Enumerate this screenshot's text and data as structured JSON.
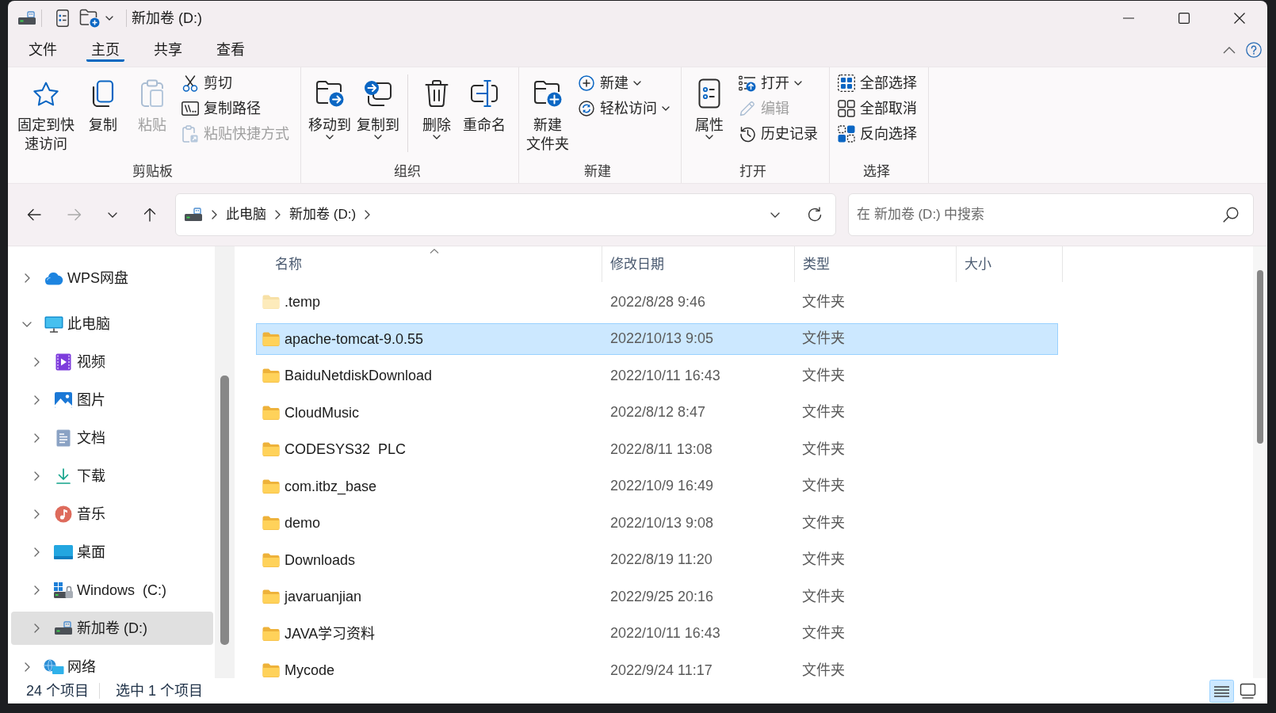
{
  "window": {
    "title": "新加卷 (D:)"
  },
  "ribbon_tabs": [
    {
      "label": "文件",
      "selected": false
    },
    {
      "label": "主页",
      "selected": true
    },
    {
      "label": "共享",
      "selected": false
    },
    {
      "label": "查看",
      "selected": false
    }
  ],
  "ribbon": {
    "groups": [
      {
        "label": "剪贴板",
        "items": [
          {
            "kind": "large",
            "label_lines": [
              "固定到快",
              "速访问"
            ],
            "dropdown": false,
            "disabled": false
          },
          {
            "kind": "large",
            "label": "复制",
            "dropdown": false,
            "disabled": false
          },
          {
            "kind": "large",
            "label": "粘贴",
            "dropdown": false,
            "disabled": true
          },
          {
            "kind": "stack",
            "items": [
              {
                "label": "剪切",
                "dropdown": false,
                "disabled": false
              },
              {
                "label": "复制路径",
                "dropdown": false,
                "disabled": false
              },
              {
                "label": "粘贴快捷方式",
                "dropdown": false,
                "disabled": true
              }
            ]
          }
        ]
      },
      {
        "label": "组织",
        "items": [
          {
            "kind": "large",
            "label": "移动到",
            "dropdown": true,
            "disabled": false
          },
          {
            "kind": "large",
            "label": "复制到",
            "dropdown": true,
            "disabled": false
          },
          {
            "kind": "separator"
          },
          {
            "kind": "large",
            "label": "删除",
            "dropdown": true,
            "disabled": false
          },
          {
            "kind": "large",
            "label": "重命名",
            "dropdown": false,
            "disabled": false
          }
        ]
      },
      {
        "label": "新建",
        "items": [
          {
            "kind": "large",
            "label_lines": [
              "新建",
              "文件夹"
            ],
            "dropdown": false,
            "disabled": false
          },
          {
            "kind": "stack",
            "items": [
              {
                "label": "新建",
                "dropdown": true,
                "disabled": false
              },
              {
                "label": "轻松访问",
                "dropdown": true,
                "disabled": false
              }
            ]
          }
        ]
      },
      {
        "label": "打开",
        "items": [
          {
            "kind": "large",
            "label": "属性",
            "dropdown": true,
            "disabled": false
          },
          {
            "kind": "stack",
            "items": [
              {
                "label": "打开",
                "dropdown": true,
                "disabled": false
              },
              {
                "label": "编辑",
                "dropdown": false,
                "disabled": true
              },
              {
                "label": "历史记录",
                "dropdown": false,
                "disabled": false
              }
            ]
          }
        ]
      },
      {
        "label": "选择",
        "items": [
          {
            "kind": "stack",
            "items": [
              {
                "label": "全部选择",
                "dropdown": false,
                "disabled": false
              },
              {
                "label": "全部取消",
                "dropdown": false,
                "disabled": false
              },
              {
                "label": "反向选择",
                "dropdown": false,
                "disabled": false
              }
            ]
          }
        ]
      }
    ]
  },
  "navigation_buttons": [
    {
      "disabled": false
    },
    {
      "disabled": true
    },
    {
      "disabled": false
    },
    {
      "disabled": false
    }
  ],
  "address_bar": {
    "breadcrumbs": [
      {
        "label": "此电脑"
      },
      {
        "label": "新加卷 (D:)"
      }
    ]
  },
  "search": {
    "placeholder": "在 新加卷 (D:) 中搜索"
  },
  "navigation_pane": {
    "items": [
      {
        "label": "WPS网盘",
        "expanded": false,
        "selected": false
      },
      {
        "label": "此电脑",
        "expanded": true,
        "selected": false,
        "children": [
          {
            "label": "视频",
            "expanded": false,
            "selected": false
          },
          {
            "label": "图片",
            "expanded": false,
            "selected": false
          },
          {
            "label": "文档",
            "expanded": false,
            "selected": false
          },
          {
            "label": "下载",
            "expanded": false,
            "selected": false
          },
          {
            "label": "音乐",
            "expanded": false,
            "selected": false
          },
          {
            "label": "桌面",
            "expanded": false,
            "selected": false
          },
          {
            "label": "Windows  (C:)",
            "expanded": false,
            "selected": false
          },
          {
            "label": "新加卷 (D:)",
            "expanded": false,
            "selected": true
          }
        ]
      },
      {
        "label": "网络",
        "expanded": false,
        "selected": false
      }
    ]
  },
  "file_list": {
    "columns": [
      {
        "label": "名称",
        "sorted": true
      },
      {
        "label": "修改日期",
        "sorted": false
      },
      {
        "label": "类型",
        "sorted": false
      },
      {
        "label": "大小",
        "sorted": false
      }
    ],
    "rows": [
      {
        "name": ".temp",
        "modified": "2022/8/28 9:46",
        "type": "文件夹",
        "hidden": true,
        "selected": false
      },
      {
        "name": "apache-tomcat-9.0.55",
        "modified": "2022/10/13 9:05",
        "type": "文件夹",
        "hidden": false,
        "selected": true
      },
      {
        "name": "BaiduNetdiskDownload",
        "modified": "2022/10/11 16:43",
        "type": "文件夹",
        "hidden": false,
        "selected": false
      },
      {
        "name": "CloudMusic",
        "modified": "2022/8/12 8:47",
        "type": "文件夹",
        "hidden": false,
        "selected": false
      },
      {
        "name": "CODESYS32  PLC",
        "modified": "2022/8/11 13:08",
        "type": "文件夹",
        "hidden": false,
        "selected": false
      },
      {
        "name": "com.itbz_base",
        "modified": "2022/10/9 16:49",
        "type": "文件夹",
        "hidden": false,
        "selected": false
      },
      {
        "name": "demo",
        "modified": "2022/10/13 9:08",
        "type": "文件夹",
        "hidden": false,
        "selected": false
      },
      {
        "name": "Downloads",
        "modified": "2022/8/19 11:20",
        "type": "文件夹",
        "hidden": false,
        "selected": false
      },
      {
        "name": "javaruanjian",
        "modified": "2022/9/25 20:16",
        "type": "文件夹",
        "hidden": false,
        "selected": false
      },
      {
        "name": "JAVA学习资料",
        "modified": "2022/10/11 16:43",
        "type": "文件夹",
        "hidden": false,
        "selected": false
      },
      {
        "name": "Mycode",
        "modified": "2022/9/24 11:17",
        "type": "文件夹",
        "hidden": false,
        "selected": false
      }
    ]
  },
  "status_bar": {
    "item_count": "24 个项目",
    "selection": "选中 1 个项目",
    "view_buttons": [
      {
        "selected": true
      },
      {
        "selected": false
      }
    ]
  }
}
